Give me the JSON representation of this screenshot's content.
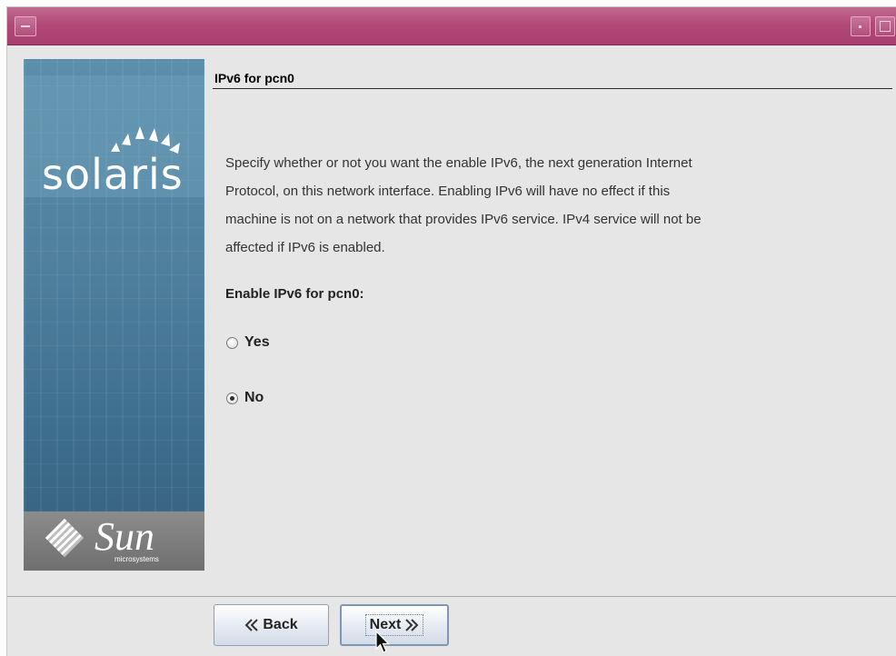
{
  "window": {
    "title": ""
  },
  "banner": {
    "brand": "solaris",
    "vendor": "Sun",
    "vendor_sub": "microsystems"
  },
  "page": {
    "heading": "IPv6 for pcn0",
    "description": [
      "Specify whether or not you want the enable IPv6, the next generation Internet",
      "Protocol, on this network interface.  Enabling IPv6 will have no effect if this",
      "machine is not on a network that provides IPv6 service.  IPv4 service will not be",
      "affected if IPv6 is enabled."
    ],
    "question": "Enable IPv6 for pcn0:",
    "options": [
      {
        "label": "Yes",
        "selected": false
      },
      {
        "label": "No",
        "selected": true
      }
    ]
  },
  "footer": {
    "back_label": "Back",
    "next_label": "Next",
    "back_icon": "chevron-left-double",
    "next_icon": "chevron-right-double"
  },
  "colors": {
    "titlebar": "#b14a78",
    "banner": "#4f809e",
    "background": "#e6e6e6"
  }
}
